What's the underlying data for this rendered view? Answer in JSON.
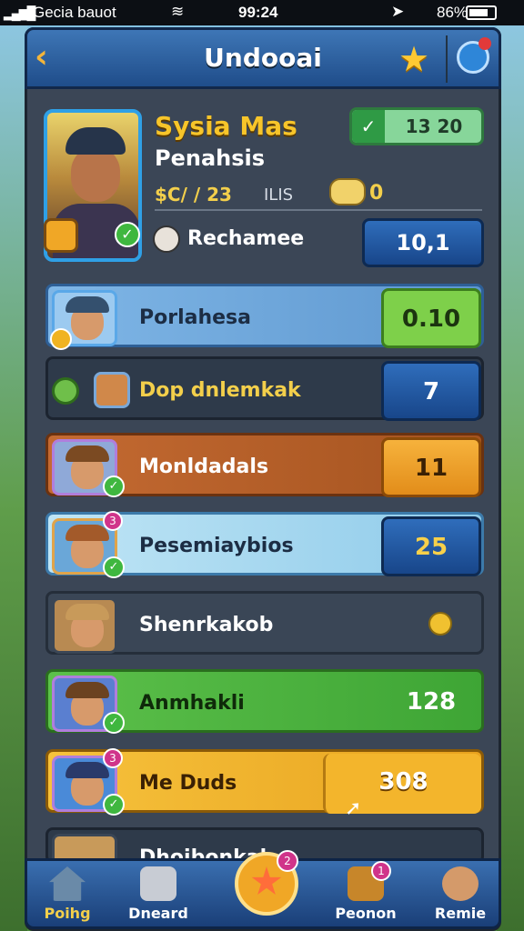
{
  "status_bar": {
    "carrier": "Gecia bauot",
    "time": "99:24",
    "battery": "86%"
  },
  "header": {
    "title": "Undooai"
  },
  "profile": {
    "name": "Sysia Mas",
    "subtitle": "Penahsis",
    "stat_main": "$C/ / 23",
    "stat_secondary": "ILIS",
    "coin_value": "0",
    "score": "13 20",
    "reward_label": "Rechamee",
    "reward_value": "10,1"
  },
  "rows": [
    {
      "label": "Porlahesa",
      "value": "0.10"
    },
    {
      "label": "Dop dnlemkak",
      "value": "7"
    },
    {
      "label": "Monldadals",
      "value": "11"
    },
    {
      "label": "Pesemiaybios",
      "value": "25"
    },
    {
      "label": "Shenrkakob",
      "value": ""
    },
    {
      "label": "Anmhakli",
      "value": "128"
    },
    {
      "label": "Me Duds",
      "value": "308"
    },
    {
      "label": "Dhoibonkak",
      "value": ""
    }
  ],
  "nav": [
    {
      "label": "Poihg",
      "badge": ""
    },
    {
      "label": "Dneard",
      "badge": ""
    },
    {
      "label": "",
      "badge": "2"
    },
    {
      "label": "Peonon",
      "badge": "1"
    },
    {
      "label": "Remie",
      "badge": ""
    }
  ],
  "icons": [
    "back-icon",
    "star-icon",
    "settings-icon",
    "checkmark-icon",
    "coin-icon",
    "home-icon",
    "map-icon",
    "chest-icon"
  ],
  "colors": {
    "accent": "#f7c52a",
    "panel": "#3b4656",
    "header": "#2a5fa0"
  }
}
